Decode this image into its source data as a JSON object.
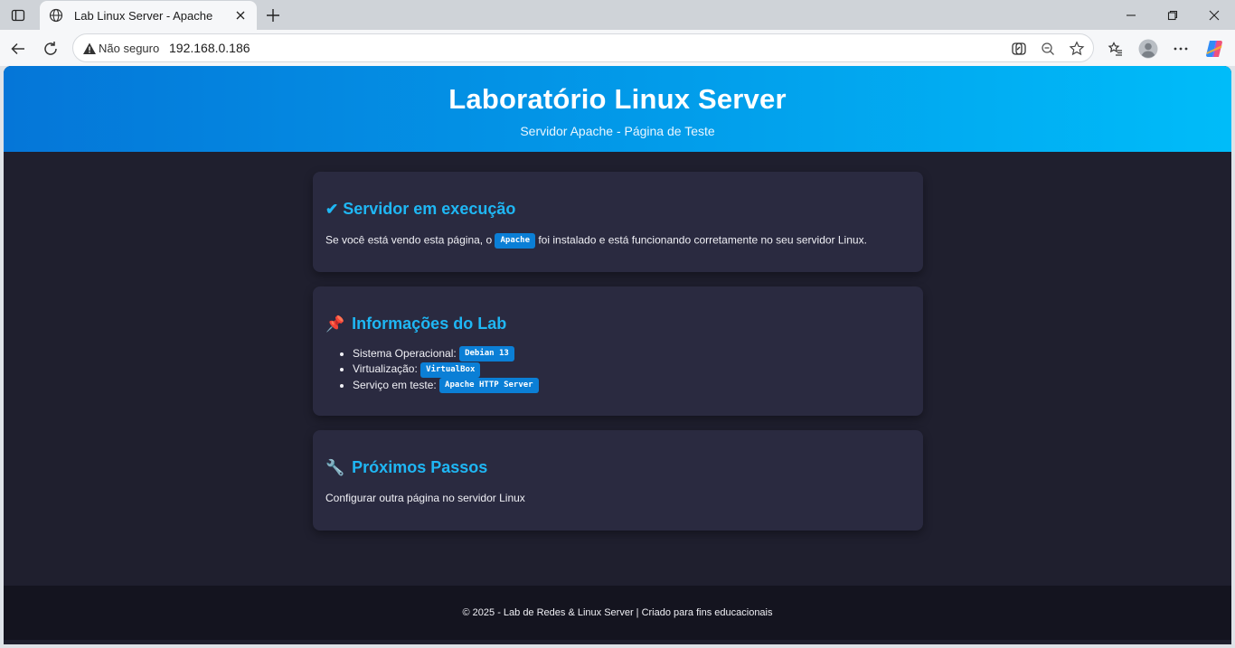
{
  "browser": {
    "tab_title": "Lab Linux Server - Apache",
    "not_secure_label": "Não seguro",
    "url": "192.168.0.186"
  },
  "page": {
    "hero": {
      "title": "Laboratório Linux Server",
      "subtitle": "Servidor Apache - Página de Teste"
    },
    "card_running": {
      "icon": "✔",
      "heading": "Servidor em execução",
      "text_before": "Se você está vendo esta página, o",
      "code": "Apache",
      "text_after": "foi instalado e está funcionando corretamente no seu servidor Linux."
    },
    "card_info": {
      "icon": "📌",
      "heading": "Informações do Lab",
      "items": [
        {
          "label": "Sistema Operacional:",
          "value": "Debian 13"
        },
        {
          "label": "Virtualização:",
          "value": "VirtualBox"
        },
        {
          "label": "Serviço em teste:",
          "value": "Apache HTTP Server"
        }
      ]
    },
    "card_next": {
      "icon": "🔧",
      "heading": "Próximos Passos",
      "text": "Configurar outra página no servidor Linux"
    },
    "footer": "© 2025 - Lab de Redes & Linux Server | Criado para fins educacionais"
  }
}
